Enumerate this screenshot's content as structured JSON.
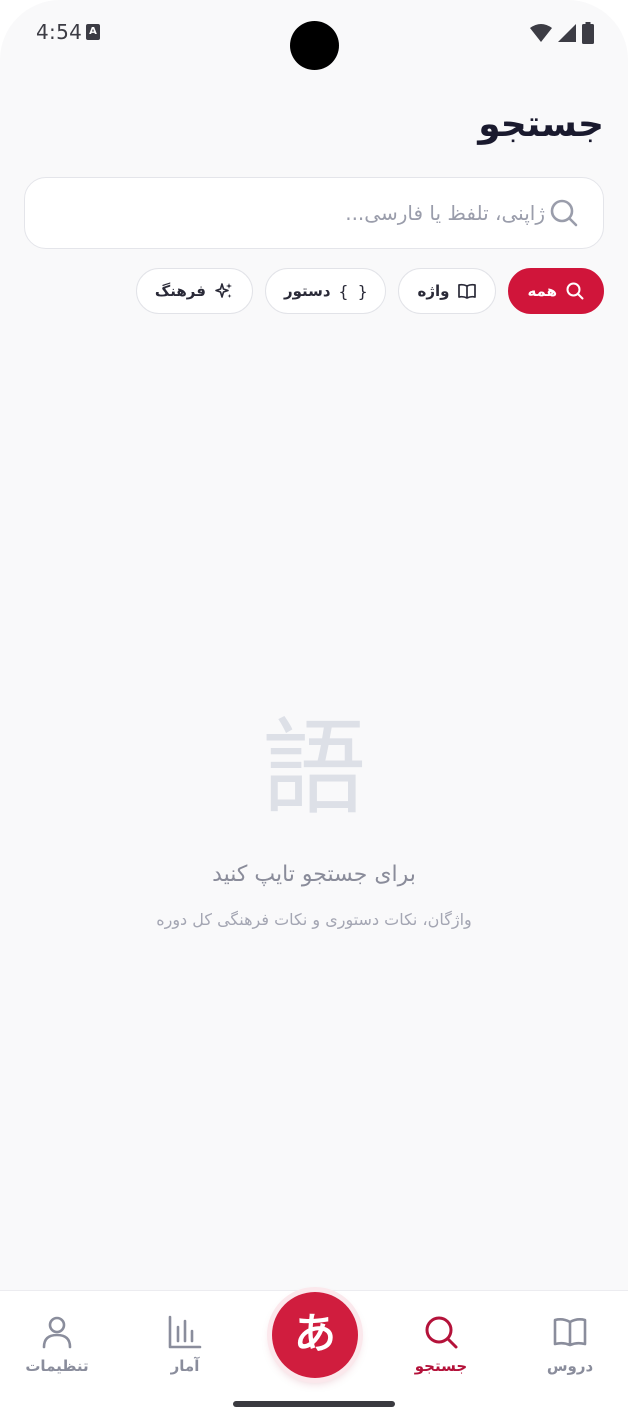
{
  "status_bar": {
    "time": "4:54",
    "notification_icon": "A"
  },
  "header": {
    "title": "جستجو"
  },
  "search": {
    "placeholder": "ژاپنی، تلفظ یا فارسی...",
    "value": ""
  },
  "filters": [
    {
      "label": "همه",
      "icon": "search-icon",
      "active": true
    },
    {
      "label": "واژه",
      "icon": "book-icon",
      "active": false
    },
    {
      "label": "دستور",
      "icon": "braces-icon",
      "active": false
    },
    {
      "label": "فرهنگ",
      "icon": "sparkles-icon",
      "active": false
    }
  ],
  "empty_state": {
    "glyph": "語",
    "title": "برای جستجو تایپ کنید",
    "subtitle": "واژگان، نکات دستوری و نکات فرهنگی کل دوره"
  },
  "bottom_nav": {
    "lessons": "دروس",
    "search": "جستجو",
    "fab": "あ",
    "stats": "آمار",
    "settings": "تنظیمات"
  },
  "colors": {
    "accent": "#d0153a",
    "background": "#f9f9fa",
    "muted_text": "#8a8d9c"
  }
}
